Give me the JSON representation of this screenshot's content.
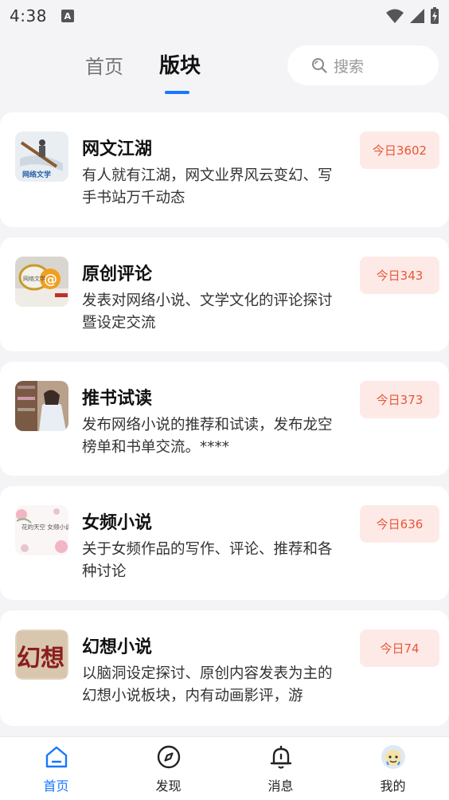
{
  "status_bar": {
    "time": "4:38",
    "a_icon": "A"
  },
  "header": {
    "tabs": [
      {
        "label": "首页",
        "active": false
      },
      {
        "label": "版块",
        "active": true
      }
    ],
    "search": {
      "placeholder": "搜索",
      "icon": "search-icon"
    }
  },
  "forums": [
    {
      "title": "网文江湖",
      "desc": "有人就有江湖，网文业界风云变幻、写手书站万千动态",
      "badge": "今日3602",
      "thumb": "网络文学"
    },
    {
      "title": "原创评论",
      "desc": "发表对网络小说、文学文化的评论探讨暨设定交流",
      "badge": "今日343",
      "thumb": "网络文学"
    },
    {
      "title": "推书试读",
      "desc": "发布网络小说的推荐和试读，发布龙空榜单和书单交流。****",
      "badge": "今日373"
    },
    {
      "title": "女频小说",
      "desc": "关于女频作品的写作、评论、推荐和各种讨论",
      "badge": "今日636",
      "thumb": "花的天空 女频小说"
    },
    {
      "title": "幻想小说",
      "desc": "以脑洞设定探讨、原创内容发表为主的幻想小说板块，内有动画影评，游",
      "badge": "今日74",
      "thumb": "幻想"
    }
  ],
  "bottom_nav": [
    {
      "label": "首页",
      "icon": "home-icon",
      "active": true
    },
    {
      "label": "发现",
      "icon": "compass-icon",
      "active": false
    },
    {
      "label": "消息",
      "icon": "bell-icon",
      "active": false
    },
    {
      "label": "我的",
      "icon": "avatar",
      "active": false
    }
  ],
  "colors": {
    "accent": "#1677ff",
    "badge_bg": "#fdeae6",
    "badge_text": "#e8563a"
  }
}
